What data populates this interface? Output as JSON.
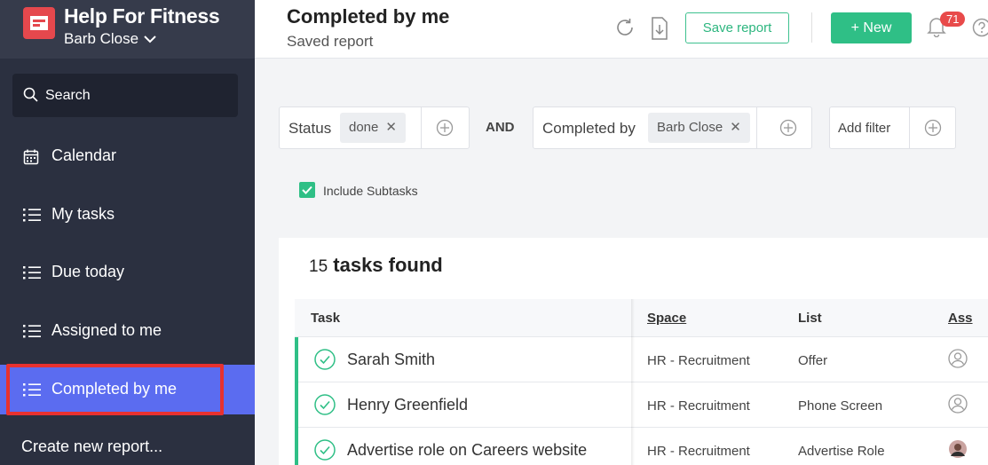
{
  "brand": {
    "name": "Help For Fitness",
    "user": "Barb Close"
  },
  "search": {
    "label": "Search"
  },
  "nav": [
    {
      "label": "Calendar",
      "icon": "calendar-icon"
    },
    {
      "label": "My tasks",
      "icon": "list-icon"
    },
    {
      "label": "Due today",
      "icon": "list-icon"
    },
    {
      "label": "Assigned to me",
      "icon": "list-icon"
    },
    {
      "label": "Completed by me",
      "icon": "list-icon",
      "active": true
    }
  ],
  "create_report": "Create new report...",
  "header": {
    "title": "Completed by me",
    "subtitle": "Saved report",
    "save_label": "Save report",
    "new_label": "New",
    "notif_count": "71"
  },
  "filters": {
    "status_label": "Status",
    "status_value": "done",
    "and_label": "AND",
    "completed_label": "Completed by",
    "completed_value": "Barb Close",
    "add_filter": "Add filter",
    "include_subtasks": "Include Subtasks"
  },
  "results": {
    "count": "15",
    "count_suffix": "tasks found",
    "columns": {
      "task": "Task",
      "space": "Space",
      "list": "List",
      "assignee": "Ass"
    },
    "rows": [
      {
        "task": "Sarah Smith",
        "space": "HR - Recruitment",
        "list": "Offer"
      },
      {
        "task": "Henry Greenfield",
        "space": "HR - Recruitment",
        "list": "Phone Screen"
      },
      {
        "task": "Advertise role on Careers website",
        "space": "HR - Recruitment",
        "list": "Advertise Role"
      }
    ]
  },
  "colors": {
    "sidebar": "#2b3040",
    "active": "#5b6cf0",
    "accent": "#2fbf86",
    "highlight": "#e8312f"
  }
}
